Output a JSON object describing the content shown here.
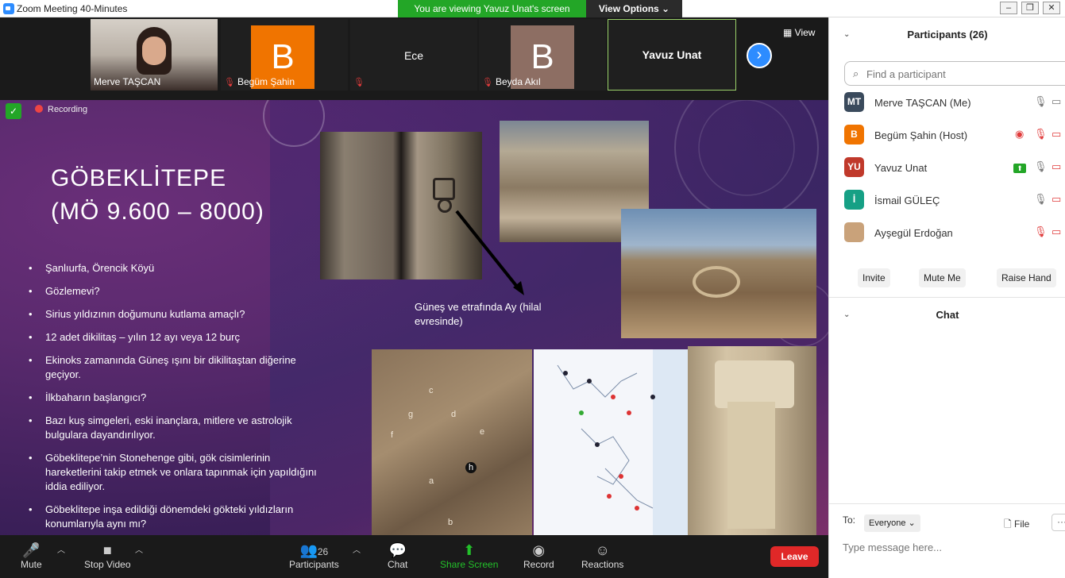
{
  "window": {
    "title": "Zoom Meeting 40-Minutes"
  },
  "banner": {
    "viewing": "You are viewing Yavuz Unat's screen",
    "view_options": "View Options ⌄"
  },
  "strip": {
    "tiles": [
      {
        "name": "Merve TAŞCAN"
      },
      {
        "name": "Begüm Şahin",
        "initial": "B"
      },
      {
        "name": "Ece"
      },
      {
        "name": "Beyda Akıl",
        "initial": "B"
      },
      {
        "name": "Yavuz Unat"
      }
    ],
    "view_label": "View"
  },
  "share": {
    "recording": "Recording",
    "title_line1": "GÖBEKLİTEPE",
    "title_line2": "(MÖ 9.600 – 8000)",
    "bullets": [
      "Şanlıurfa, Örencik Köyü",
      "Gözlemevi?",
      "Sirius yıldızının doğumunu kutlama amaçlı?",
      "12 adet dikilitaş – yılın 12 ayı veya 12 burç",
      "Ekinoks zamanında Güneş ışını bir dikilitaştan diğerine geçiyor.",
      "İlkbaharın başlangıcı?",
      "Bazı kuş simgeleri, eski inançlara, mitlere ve astrolojik bulgulara dayandırılıyor.",
      "Göbeklitepe’nin Stonehenge gibi, gök cisimlerinin hareketlerini takip etmek ve onlara tapınmak için yapıldığını iddia ediliyor.",
      "Göbeklitepe inşa edildiği dönemdeki gökteki yıldızların konumlarıyla aynı mı?"
    ],
    "caption": "Güneş ve etrafında Ay (hilal evresinde)",
    "relief_letters": [
      "c",
      "g",
      "d",
      "e",
      "f",
      "h",
      "a",
      "b"
    ]
  },
  "toolbar": {
    "mute": "Mute",
    "stop_video": "Stop Video",
    "participants": "Participants",
    "participant_count": "26",
    "chat": "Chat",
    "share_screen": "Share Screen",
    "record": "Record",
    "reactions": "Reactions",
    "leave": "Leave"
  },
  "panel": {
    "participants_title": "Participants (26)",
    "search_placeholder": "Find a participant",
    "participants": [
      {
        "initials": "MT",
        "name": "Merve TAŞCAN (Me)",
        "color": "#3a4a5c"
      },
      {
        "initials": "B",
        "name": "Begüm Şahin (Host)",
        "color": "#f07400"
      },
      {
        "initials": "YU",
        "name": "Yavuz Unat",
        "color": "#c0392b"
      },
      {
        "initials": "İ",
        "name": "İsmail GÜLEÇ",
        "color": "#16a085"
      },
      {
        "initials": "",
        "name": "Ayşegül Erdoğan",
        "color": "#c9a27a"
      }
    ],
    "invite": "Invite",
    "mute_me": "Mute Me",
    "raise_hand": "Raise Hand",
    "chat_title": "Chat",
    "to_label": "To:",
    "to_value": "Everyone ⌄",
    "file_label": "File",
    "message_placeholder": "Type message here..."
  },
  "colors": {
    "zoom_blue": "#2d8cff",
    "green": "#23a627",
    "leave_red": "#e02828"
  }
}
